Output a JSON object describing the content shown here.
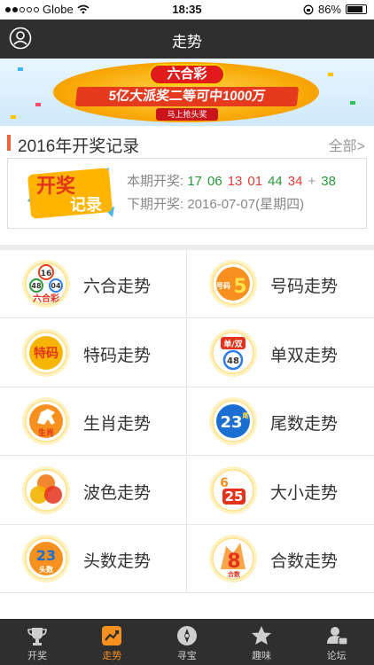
{
  "status_bar": {
    "carrier": "Globe",
    "time": "18:35",
    "battery": "86%",
    "battery_level": 0.86
  },
  "nav": {
    "title": "走势"
  },
  "banner": {
    "brand": "六合彩",
    "headline": "5亿大派奖二等可中1000万",
    "cta": "马上抢头奖"
  },
  "record": {
    "title": "2016年开奖记录",
    "more": "全部>",
    "logo_text_1": "开奖",
    "logo_text_2": "记录",
    "current_label": "本期开奖:",
    "numbers": [
      {
        "value": "17",
        "color": "#2b9a3e"
      },
      {
        "value": "06",
        "color": "#2b9a3e"
      },
      {
        "value": "13",
        "color": "#e33b3b"
      },
      {
        "value": "01",
        "color": "#e33b3b"
      },
      {
        "value": "44",
        "color": "#2b9a3e"
      },
      {
        "value": "34",
        "color": "#e33b3b"
      }
    ],
    "plus": "+",
    "special": {
      "value": "38",
      "color": "#2b9a3e"
    },
    "next_label": "下期开奖:",
    "next_date": "2016-07-07(星期四)"
  },
  "grid": [
    {
      "label": "六合走势",
      "icon": "liuhecai-icon",
      "icon_text": "六合彩",
      "balls": [
        "16",
        "48",
        "04"
      ]
    },
    {
      "label": "号码走势",
      "icon": "number-icon",
      "icon_text": "号码",
      "big": "5"
    },
    {
      "label": "特码走势",
      "icon": "special-number-icon",
      "icon_text": "特码"
    },
    {
      "label": "单双走势",
      "icon": "odd-even-icon",
      "icon_text": "单/双",
      "ball": "48"
    },
    {
      "label": "生肖走势",
      "icon": "zodiac-horse-icon",
      "icon_text": "生肖"
    },
    {
      "label": "尾数走势",
      "icon": "tail-number-icon",
      "big": "23",
      "icon_text": "尾"
    },
    {
      "label": "波色走势",
      "icon": "wave-color-icon"
    },
    {
      "label": "大小走势",
      "icon": "big-small-icon",
      "small": "6",
      "big": "25"
    },
    {
      "label": "头数走势",
      "icon": "head-number-icon",
      "big": "23",
      "icon_text": "头数"
    },
    {
      "label": "合数走势",
      "icon": "sum-number-icon",
      "big": "8",
      "icon_text": "合数"
    }
  ],
  "tabs": [
    {
      "label": "开奖",
      "icon": "trophy-icon",
      "active": false
    },
    {
      "label": "走势",
      "icon": "trend-icon",
      "active": true
    },
    {
      "label": "寻宝",
      "icon": "compass-icon",
      "active": false
    },
    {
      "label": "趣味",
      "icon": "star-icon",
      "active": false
    },
    {
      "label": "论坛",
      "icon": "forum-user-icon",
      "active": false
    }
  ],
  "colors": {
    "nav_bg": "#2f2f2f",
    "accent": "#f7901e",
    "green": "#2b9a3e",
    "red": "#e33b3b"
  }
}
